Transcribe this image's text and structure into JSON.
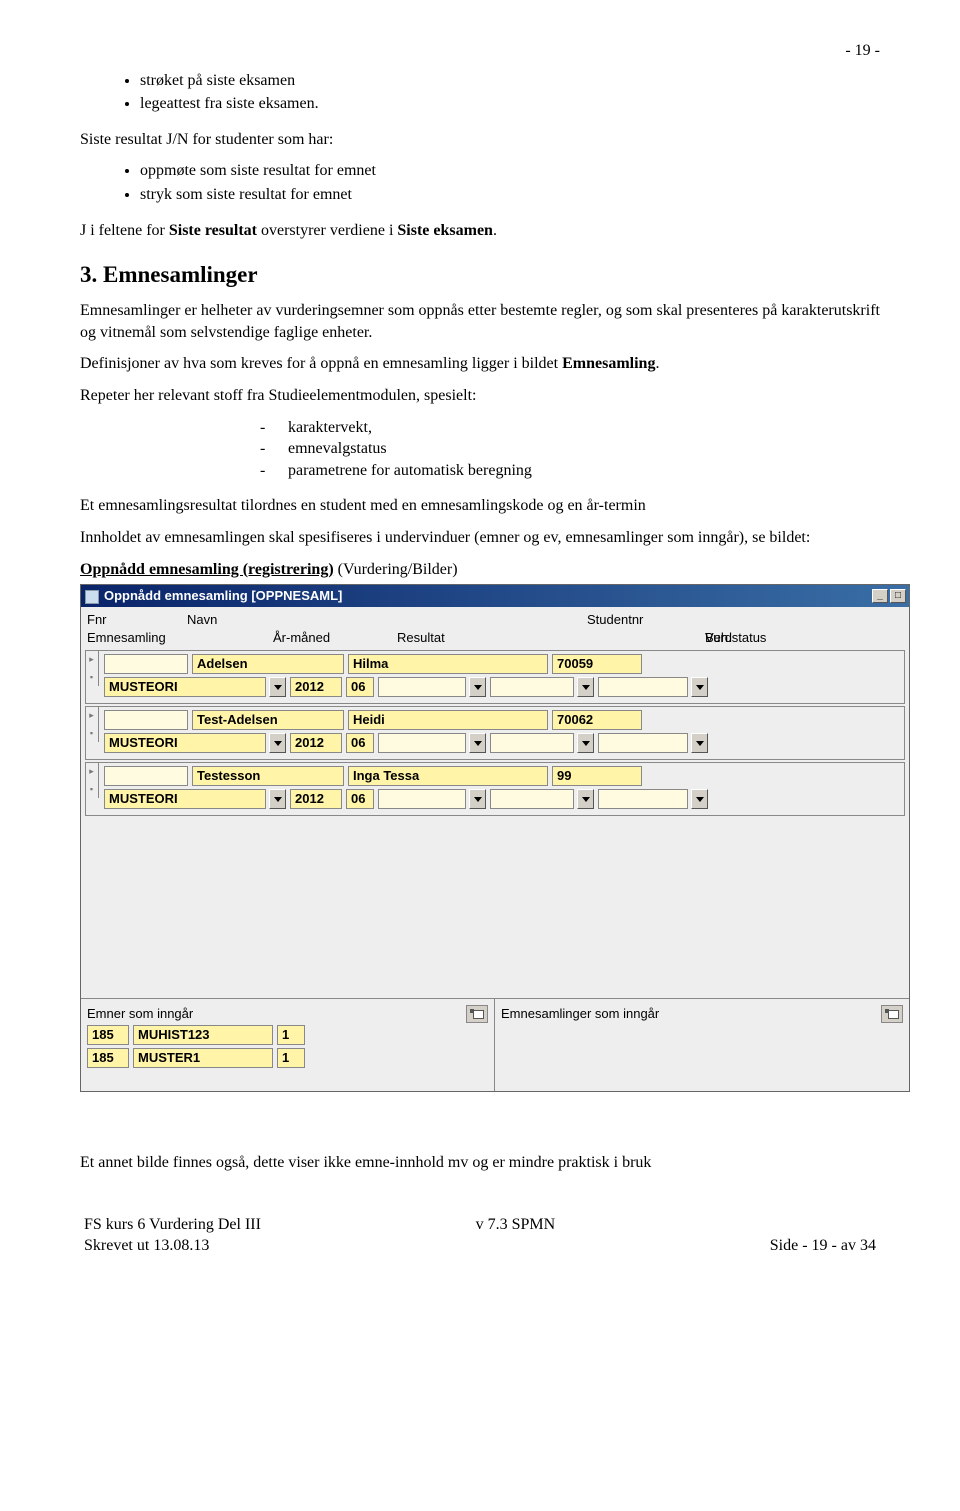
{
  "page_number_top": "- 19 -",
  "bullets_top": [
    "strøket på siste eksamen",
    "legeattest fra siste eksamen."
  ],
  "siste_intro": "Siste resultat J/N for studenter som har:",
  "bullets_siste": [
    "oppmøte som siste resultat for emnet",
    "stryk som siste resultat for emnet"
  ],
  "j_line_pre": "J i feltene for ",
  "j_line_bold1": "Siste resultat",
  "j_line_mid": " overstyrer verdiene i ",
  "j_line_bold2": "Siste eksamen",
  "j_line_post": ".",
  "section_heading": "3. Emnesamlinger",
  "para1": "Emnesamlinger er helheter av vurderingsemner som oppnås etter bestemte regler, og som skal presenteres på karakterutskrift og vitnemål som selvstendige faglige enheter.",
  "para2_pre": "Definisjoner av hva som kreves for å oppnå en emnesamling ligger i bildet ",
  "para2_bold": "Emnesamling",
  "para2_post": ".",
  "para3": "Repeter her relevant stoff fra Studieelementmodulen, spesielt:",
  "dash_items": [
    "karaktervekt,",
    "emnevalgstatus",
    "parametrene for automatisk beregning"
  ],
  "para4": "Et emnesamlingsresultat tilordnes en student med en emnesamlingskode og en år-termin",
  "para5": "Innholdet av emnesamlingen skal spesifiseres i undervinduer (emner og ev, emnesamlinger som inngår), se bildet:",
  "caption_bold_u": "Oppnådd emnesamling (registrering)",
  "caption_rest": " (Vurdering/Bilder)",
  "win": {
    "title": "Oppnådd emnesamling  [OPPNESAML]",
    "cols1": {
      "fnr": "Fnr",
      "navn": "Navn",
      "studentnr": "Studentnr"
    },
    "cols2": {
      "emnesamling": "Emnesamling",
      "aarmaned": "År-måned",
      "resultat": "Resultat",
      "vurd": "Vurd",
      "behstatus": "Beh.status"
    },
    "records": [
      {
        "fnr": "",
        "fornavn": "Adelsen",
        "etternavn": "Hilma",
        "studentnr": "70059",
        "emnesamling": "MUSTEORI",
        "aar": "2012",
        "maned": "06",
        "resultat": "",
        "vurd": "",
        "beh": ""
      },
      {
        "fnr": "",
        "fornavn": "Test-Adelsen",
        "etternavn": "Heidi",
        "studentnr": "70062",
        "emnesamling": "MUSTEORI",
        "aar": "2012",
        "maned": "06",
        "resultat": "",
        "vurd": "",
        "beh": ""
      },
      {
        "fnr": "",
        "fornavn": "Testesson",
        "etternavn": "Inga Tessa",
        "studentnr": "99",
        "emnesamling": "MUSTEORI",
        "aar": "2012",
        "maned": "06",
        "resultat": "",
        "vurd": "",
        "beh": ""
      }
    ],
    "sub_left_title": "Emner som inngår",
    "sub_right_title": "Emnesamlinger som inngår",
    "sub_rows": [
      {
        "a": "185",
        "b": "MUHIST123",
        "c": "1"
      },
      {
        "a": "185",
        "b": "MUSTER1",
        "c": "1"
      }
    ]
  },
  "after_para": "Et annet bilde finnes også, dette viser ikke emne-innhold mv og er mindre praktisk i bruk",
  "footer": {
    "left1": "FS kurs 6 Vurdering Del III",
    "left2": "Skrevet ut 13.08.13",
    "mid": "v 7.3 SPMN",
    "right": "Side - 19 - av 34"
  }
}
